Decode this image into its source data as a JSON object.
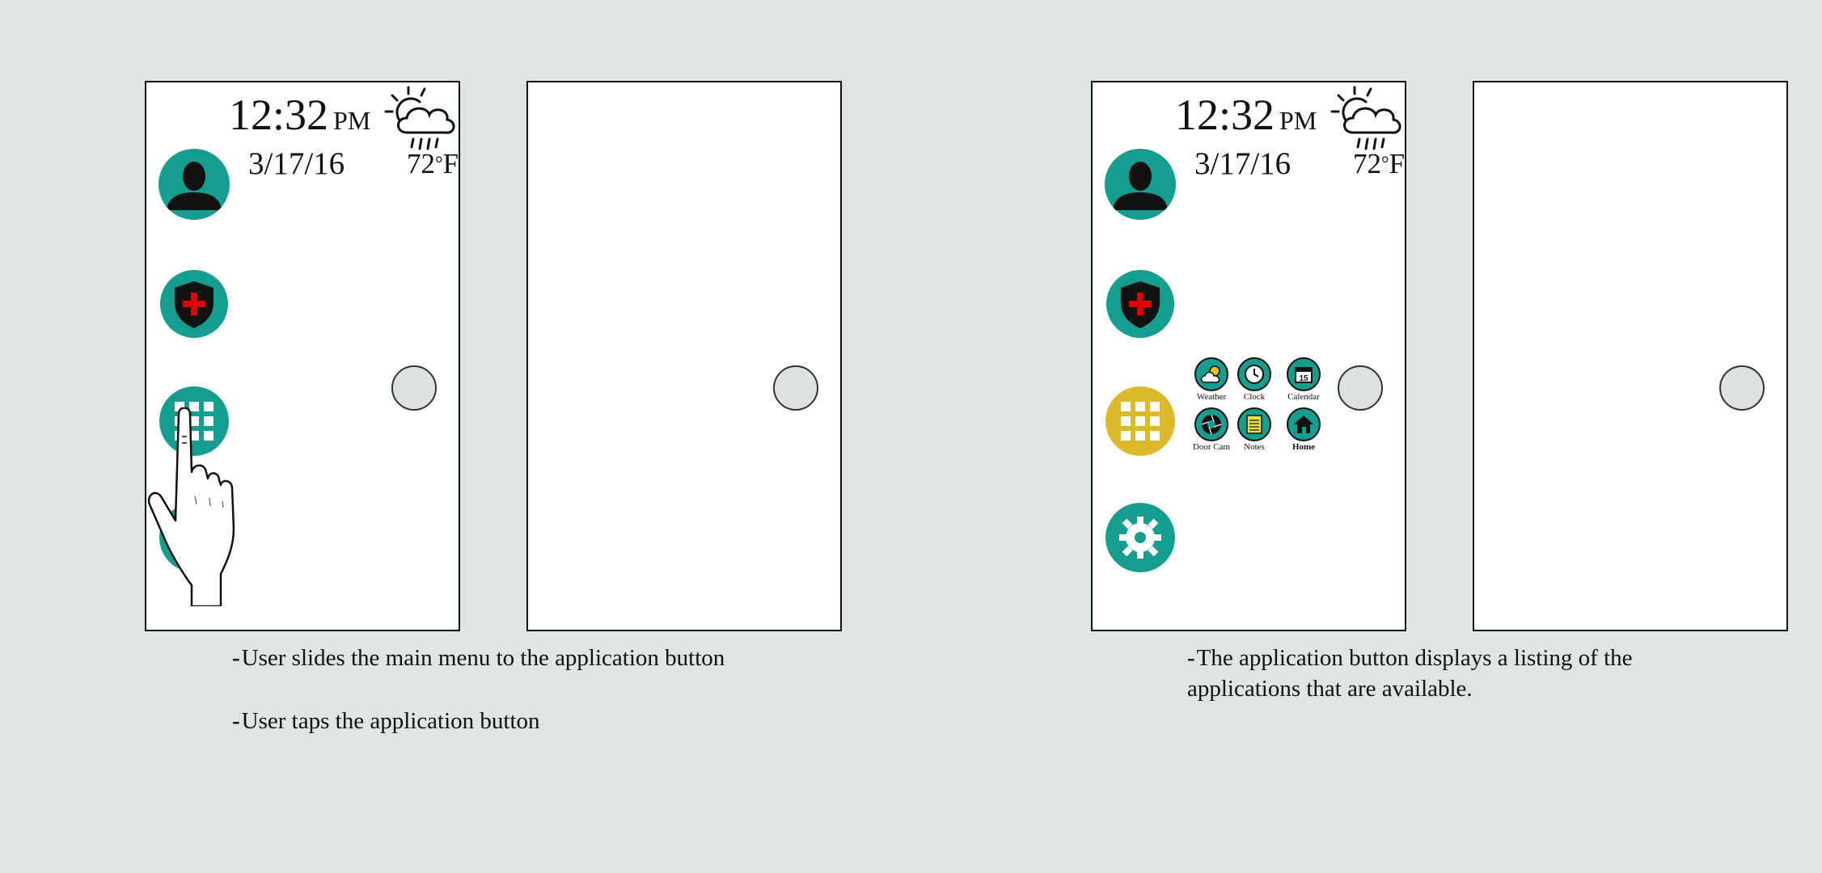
{
  "screen": {
    "time": "12:32",
    "ampm": "PM",
    "date": "3/17/16",
    "temperature": "72",
    "temp_unit": "F",
    "weather_icon": "sun-cloud-rain-icon"
  },
  "menu_buttons": [
    {
      "name": "user",
      "icon": "user-silhouette-icon"
    },
    {
      "name": "health",
      "icon": "shield-plus-icon"
    },
    {
      "name": "applications",
      "icon": "grid-icon"
    },
    {
      "name": "settings",
      "icon": "gear-icon"
    }
  ],
  "apps": [
    {
      "label": "Weather",
      "icon": "weather-icon"
    },
    {
      "label": "Clock",
      "icon": "clock-icon"
    },
    {
      "label": "Calendar",
      "icon": "calendar-icon",
      "badge": "15"
    },
    {
      "label": "Door Cam",
      "icon": "camera-aperture-icon"
    },
    {
      "label": "Notes",
      "icon": "notes-icon"
    },
    {
      "label": "Home",
      "icon": "house-icon"
    }
  ],
  "captions": {
    "left_1": "User slides the main menu to the application button",
    "left_2": "User taps the application button",
    "right_1": "The application button displays a listing of the applications that are available."
  },
  "colors": {
    "teal": "#159e8f",
    "gold_active": "#dcb92a",
    "background": "#dfe4e4",
    "cross_red": "#e00000"
  }
}
